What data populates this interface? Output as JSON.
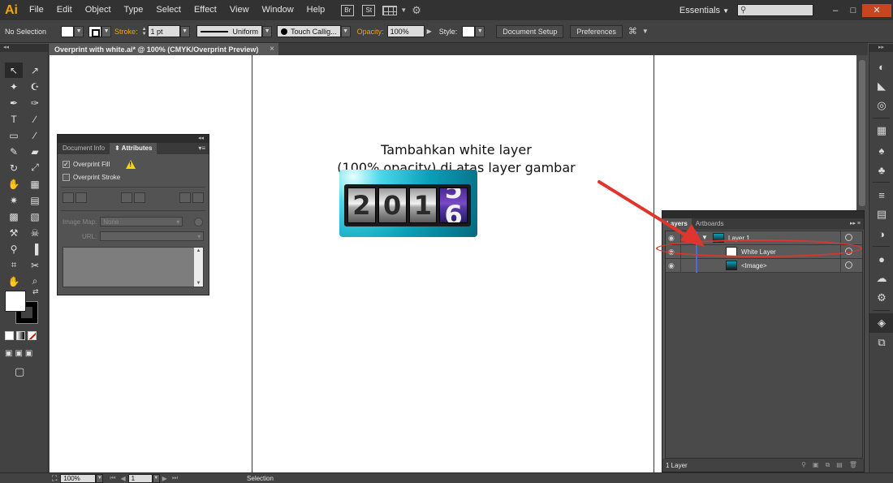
{
  "menubar": {
    "logo": "Ai",
    "items": [
      "File",
      "Edit",
      "Object",
      "Type",
      "Select",
      "Effect",
      "View",
      "Window",
      "Help"
    ],
    "bridge_icon": "Br",
    "stock_icon": "St",
    "workspace": "Essentials",
    "win_minimize": "–",
    "win_restore": "□",
    "win_close": "✕"
  },
  "control": {
    "selection": "No Selection",
    "stroke_label": "Stroke:",
    "stroke_weight": "1 pt",
    "profile": "Uniform",
    "brush": "Touch Callig...",
    "opacity_label": "Opacity:",
    "opacity_value": "100%",
    "style_label": "Style:",
    "doc_setup": "Document Setup",
    "preferences": "Preferences"
  },
  "document": {
    "tab_title": "Overprint with white.ai* @ 100% (CMYK/Overprint Preview)",
    "tab_close": "×"
  },
  "canvas": {
    "annotation_line1": "Tambahkan white layer",
    "annotation_line2": "(100% opacity) di atas layer gambar",
    "image_digits": [
      "2",
      "0",
      "1"
    ],
    "image_digit_top": "5",
    "image_digit_bottom": "6"
  },
  "attributes_panel": {
    "titlebar": "◂◂",
    "tab_doc_info": "Document Info",
    "tab_attributes": "⬍ Attributes",
    "menu": "▾≡",
    "overprint_fill": "Overprint Fill",
    "overprint_fill_checked": "✓",
    "overprint_stroke": "Overprint Stroke",
    "image_map_label": "Image Map:",
    "image_map_value": "None",
    "url_label": "URL:",
    "select_arrow": "▾"
  },
  "layers_panel": {
    "tab_layers": "Layers",
    "tab_artboards": "Artboards",
    "tabs_right": "▸▸ ≡",
    "layers": [
      {
        "name": "Layer 1",
        "expanded": true,
        "thumb": "image"
      },
      {
        "name": "White Layer",
        "thumb": "white"
      },
      {
        "name": "<Image>",
        "thumb": "image"
      }
    ],
    "footer": "1 Layer",
    "eye_glyph": "👁",
    "expand_glyph": "▼"
  },
  "tools": {
    "header": "◂◂",
    "glyphs": [
      "↖",
      "↗",
      "✦",
      "☪",
      "✒",
      "✑",
      "T",
      "∕",
      "▭",
      "∕",
      "✎",
      "▰",
      "↻",
      "⤢",
      "✋",
      "▦",
      "✷",
      "▤",
      "▩",
      "▧",
      "⚒",
      "☠",
      "⚲",
      "▐",
      "⌗",
      "✂",
      "✋",
      "⌕"
    ],
    "swap": "⇄",
    "draw_modes": [
      "▣",
      "▣",
      "▣"
    ],
    "screen_mode": "▢"
  },
  "dock": {
    "header": "▸▸",
    "icons": [
      "◐",
      "◣",
      "◎",
      "▦",
      "♠",
      "♣",
      "≡",
      "▤",
      "◑",
      "●",
      "☁",
      "⚙",
      "☰",
      "◈",
      "⧉"
    ]
  },
  "status": {
    "zoom": "100%",
    "artboard": "1",
    "tool": "Selection",
    "nav_first": "⏮",
    "nav_prev": "◀",
    "nav_next": "▶",
    "nav_last": "⏭"
  },
  "colors": {
    "accent": "#f0a30a",
    "annotation_red": "#e0352c",
    "layer_blue": "#4a6bd8"
  }
}
